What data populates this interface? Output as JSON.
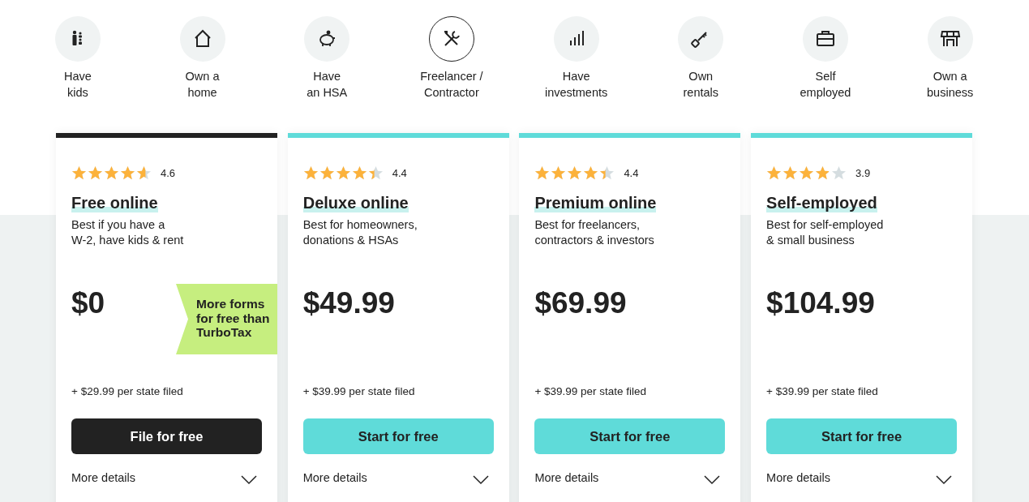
{
  "filters": [
    {
      "line1": "Have",
      "line2": "kids",
      "selected": false
    },
    {
      "line1": "Own a",
      "line2": "home",
      "selected": false
    },
    {
      "line1": "Have",
      "line2": "an HSA",
      "selected": false
    },
    {
      "line1": "Freelancer /",
      "line2": "Contractor",
      "selected": true
    },
    {
      "line1": "Have",
      "line2": "investments",
      "selected": false
    },
    {
      "line1": "Own",
      "line2": "rentals",
      "selected": false
    },
    {
      "line1": "Self",
      "line2": "employed",
      "selected": false
    },
    {
      "line1": "Own a",
      "line2": "business",
      "selected": false
    }
  ],
  "plans": [
    {
      "stars": 4.6,
      "rating": "4.6",
      "title": "Free online",
      "description_1": "Best if you have a",
      "description_2": "W-2, have kids & rent",
      "price": "$0",
      "badge": "More forms for free than TurboTax",
      "state_fee": "+ $29.99 per state filed",
      "button": "File for free",
      "selected": true,
      "details": "More details"
    },
    {
      "stars": 4.4,
      "rating": "4.4",
      "title": "Deluxe online",
      "description_1": "Best for homeowners,",
      "description_2": "donations & HSAs",
      "price": "$49.99",
      "state_fee": "+ $39.99 per state filed",
      "button": "Start for free",
      "selected": false,
      "details": "More details"
    },
    {
      "stars": 4.4,
      "rating": "4.4",
      "title": "Premium online",
      "description_1": "Best for freelancers,",
      "description_2": "contractors & investors",
      "price": "$69.99",
      "state_fee": "+ $39.99 per state filed",
      "button": "Start for free",
      "selected": false,
      "details": "More details"
    },
    {
      "stars": 3.9,
      "rating": "3.9",
      "title": "Self-employed",
      "description_1": "Best for self-employed",
      "description_2": "& small business",
      "price": "$104.99",
      "state_fee": "+ $39.99 per state filed",
      "button": "Start for free",
      "selected": false,
      "details": "More details"
    }
  ]
}
